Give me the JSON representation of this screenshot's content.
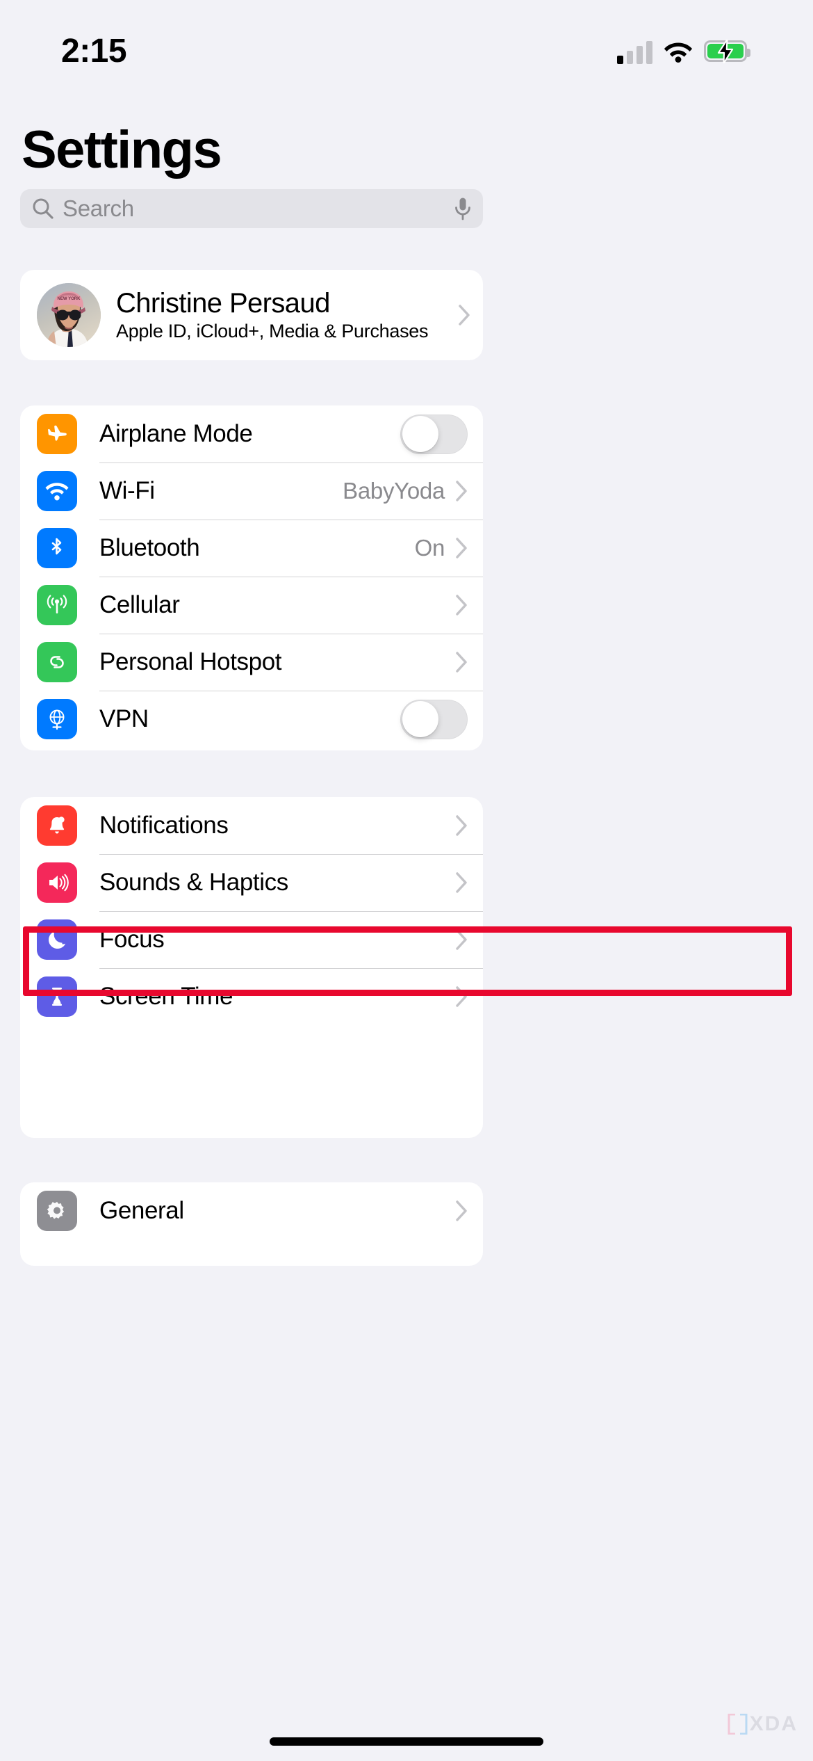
{
  "status_bar": {
    "time": "2:15",
    "signal_bars_filled": 1,
    "signal_bars_total": 4,
    "wifi": "wifi-icon",
    "battery": "battery-charging-icon",
    "battery_color": "#2ACF4D"
  },
  "header": {
    "title": "Settings"
  },
  "search": {
    "placeholder": "Search",
    "icon": "search-icon",
    "mic_icon": "microphone-icon"
  },
  "profile": {
    "name": "Christine Persaud",
    "subtitle": "Apple ID, iCloud+, Media & Purchases",
    "avatar": "user-avatar"
  },
  "groups": [
    {
      "id": "connectivity",
      "rows": [
        {
          "label": "Airplane Mode",
          "icon": "airplane-icon",
          "icon_color": "#FF9500",
          "accessory": "toggle",
          "toggle_on": false
        },
        {
          "label": "Wi-Fi",
          "icon": "wifi-icon",
          "icon_color": "#007AFF",
          "accessory": "chevron",
          "value": "BabyYoda"
        },
        {
          "label": "Bluetooth",
          "icon": "bluetooth-icon",
          "icon_color": "#007AFF",
          "accessory": "chevron",
          "value": "On"
        },
        {
          "label": "Cellular",
          "icon": "antenna-icon",
          "icon_color": "#34C759",
          "accessory": "chevron",
          "value": "",
          "highlighted": true
        },
        {
          "label": "Personal Hotspot",
          "icon": "hotspot-icon",
          "icon_color": "#34C759",
          "accessory": "chevron",
          "value": ""
        },
        {
          "label": "VPN",
          "icon": "globe-icon",
          "icon_color": "#007AFF",
          "accessory": "toggle",
          "toggle_on": false
        }
      ]
    },
    {
      "id": "notifications",
      "rows": [
        {
          "label": "Notifications",
          "icon": "bell-icon",
          "icon_color": "#FF3B30",
          "accessory": "chevron",
          "value": ""
        },
        {
          "label": "Sounds & Haptics",
          "icon": "speaker-icon",
          "icon_color": "#F4285A",
          "accessory": "chevron",
          "value": ""
        },
        {
          "label": "Focus",
          "icon": "moon-icon",
          "icon_color": "#5E5CE6",
          "accessory": "chevron",
          "value": ""
        },
        {
          "label": "Screen Time",
          "icon": "hourglass-icon",
          "icon_color": "#5E5CE6",
          "accessory": "chevron",
          "value": ""
        }
      ]
    },
    {
      "id": "system",
      "rows": [
        {
          "label": "General",
          "icon": "gear-icon",
          "icon_color": "#8E8E93",
          "accessory": "chevron",
          "value": ""
        }
      ]
    }
  ],
  "highlight": {
    "target": "Cellular",
    "color": "#E8082E"
  },
  "watermark": {
    "text": "XDA"
  }
}
